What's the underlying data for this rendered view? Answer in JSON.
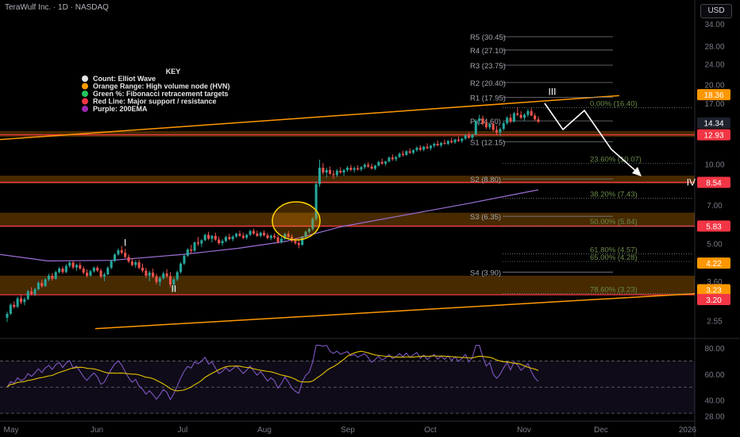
{
  "header": {
    "title": "TeraWulf Inc. · 1D · NASDAQ",
    "currency": "USD"
  },
  "key": {
    "title": "KEY",
    "items": [
      {
        "color": "#e6e6e6",
        "label": "Count: Elliot Wave"
      },
      {
        "color": "#ff9800",
        "label": "Orange Range: High volume node (HVN)"
      },
      {
        "color": "#22c55e",
        "label": "Green %: Fibonacci retracement targets"
      },
      {
        "color": "#f23645",
        "label": "Red Line: Major support / resistance"
      },
      {
        "color": "#9c27b0",
        "label": "Purple: 200EMA"
      }
    ]
  },
  "colors": {
    "up": "#26a69a",
    "down": "#ef5350",
    "orange": "#ff9800",
    "red": "#f23645",
    "ema": "#9c6fd6",
    "rsi": "#7e57c2",
    "rsi_ma": "#e6c200",
    "grid_text": "#787b86"
  },
  "chart_data": [
    {
      "type": "candlestick",
      "y_scale": "log",
      "ylim": [
        2.2,
        36
      ],
      "y_ticks": [
        "34.00",
        "28.00",
        "24.00",
        "20.00",
        "17.00",
        "14.34",
        "12.93",
        "10.00",
        "8.54",
        "7.00",
        "5.83",
        "5.00",
        "4.22",
        "3.60",
        "3.23",
        "3.20",
        "2.55"
      ],
      "x_ticks": [
        "May",
        "Jun",
        "Jul",
        "Aug",
        "Sep",
        "Oct",
        "Nov",
        "Dec",
        "2026"
      ],
      "price_labels": [
        {
          "text": "18.36",
          "value": 18.36,
          "color": "#ff9800"
        },
        {
          "text": "14.34",
          "value": 14.34,
          "color": "#1e222d"
        },
        {
          "text": "12.93",
          "value": 12.93,
          "color": "#f23645"
        },
        {
          "text": "8.54",
          "value": 8.54,
          "color": "#f23645"
        },
        {
          "text": "5.83",
          "value": 5.83,
          "color": "#f23645"
        },
        {
          "text": "4.22",
          "value": 4.22,
          "color": "#ff9800"
        },
        {
          "text": "3.23",
          "value": 3.23,
          "color": "#ff9800"
        },
        {
          "text": "3.20",
          "value": 3.2,
          "color": "#f23645"
        }
      ],
      "pivots": [
        {
          "label": "R5 (30.45)",
          "value": 30.45
        },
        {
          "label": "R4 (27.10)",
          "value": 27.1
        },
        {
          "label": "R3 (23.75)",
          "value": 23.75
        },
        {
          "label": "R2 (20.40)",
          "value": 20.4
        },
        {
          "label": "R1 (17.95)",
          "value": 17.95
        },
        {
          "label": "P (14.60)",
          "value": 14.6
        },
        {
          "label": "S1 (12.15)",
          "value": 12.15
        },
        {
          "label": "S2 (8.80)",
          "value": 8.8
        },
        {
          "label": "S3 (6.35)",
          "value": 6.35
        },
        {
          "label": "S4 (3.90)",
          "value": 3.9
        }
      ],
      "fib_levels": [
        {
          "label": "0.00% (16.40)",
          "value": 16.4
        },
        {
          "label": "23.60% (10.07)",
          "value": 10.07
        },
        {
          "label": "38.20% (7.43)",
          "value": 7.43
        },
        {
          "label": "50.00% (5.84)",
          "value": 5.84
        },
        {
          "label": "61.80% (4.57)",
          "value": 4.57
        },
        {
          "label": "65.00% (4.28)",
          "value": 4.28
        },
        {
          "label": "78.60% (3.23)",
          "value": 3.23
        }
      ],
      "hvn_zones": [
        [
          12.7,
          13.35
        ],
        [
          8.45,
          9.05
        ],
        [
          5.78,
          6.55
        ],
        [
          3.2,
          3.78
        ]
      ],
      "support_lines": [
        12.93,
        8.54,
        5.83,
        3.2
      ],
      "wave_labels": [
        {
          "text": "I",
          "value": 4.9,
          "day": 34
        },
        {
          "text": "II",
          "value": 3.28,
          "day": 48
        },
        {
          "text": "III",
          "value": 18.3,
          "day": 157
        },
        {
          "text": "IV",
          "value": 8.3,
          "day": 197
        }
      ],
      "candles": [
        [
          2.62,
          2.76,
          2.52,
          2.71
        ],
        [
          2.71,
          2.97,
          2.68,
          2.93
        ],
        [
          2.93,
          3.02,
          2.84,
          2.88
        ],
        [
          2.88,
          3.15,
          2.85,
          3.1
        ],
        [
          3.1,
          3.2,
          2.95,
          3.0
        ],
        [
          3.0,
          3.13,
          2.92,
          3.08
        ],
        [
          3.08,
          3.34,
          3.05,
          3.3
        ],
        [
          3.3,
          3.42,
          3.18,
          3.22
        ],
        [
          3.22,
          3.4,
          3.16,
          3.36
        ],
        [
          3.36,
          3.6,
          3.32,
          3.55
        ],
        [
          3.55,
          3.65,
          3.4,
          3.45
        ],
        [
          3.45,
          3.7,
          3.42,
          3.66
        ],
        [
          3.66,
          3.85,
          3.6,
          3.78
        ],
        [
          3.78,
          3.86,
          3.62,
          3.68
        ],
        [
          3.68,
          3.95,
          3.65,
          3.9
        ],
        [
          3.9,
          4.08,
          3.85,
          4.02
        ],
        [
          4.02,
          4.1,
          3.84,
          3.9
        ],
        [
          3.9,
          4.18,
          3.86,
          4.12
        ],
        [
          4.12,
          4.3,
          4.05,
          4.24
        ],
        [
          4.24,
          4.3,
          4.0,
          4.06
        ],
        [
          4.06,
          4.2,
          3.95,
          4.15
        ],
        [
          4.15,
          4.25,
          3.98,
          4.02
        ],
        [
          4.02,
          4.1,
          3.82,
          3.88
        ],
        [
          3.88,
          4.0,
          3.72,
          3.78
        ],
        [
          3.78,
          3.98,
          3.75,
          3.93
        ],
        [
          3.93,
          4.1,
          3.88,
          4.05
        ],
        [
          4.05,
          4.12,
          3.9,
          3.95
        ],
        [
          3.95,
          4.02,
          3.7,
          3.75
        ],
        [
          3.75,
          3.88,
          3.6,
          3.82
        ],
        [
          3.82,
          4.1,
          3.8,
          4.05
        ],
        [
          4.05,
          4.35,
          4.0,
          4.3
        ],
        [
          4.3,
          4.6,
          4.25,
          4.55
        ],
        [
          4.55,
          4.8,
          4.5,
          4.72
        ],
        [
          4.72,
          4.9,
          4.55,
          4.62
        ],
        [
          4.62,
          4.78,
          4.4,
          4.45
        ],
        [
          4.45,
          4.55,
          4.22,
          4.28
        ],
        [
          4.28,
          4.4,
          4.1,
          4.15
        ],
        [
          4.15,
          4.32,
          4.05,
          4.25
        ],
        [
          4.25,
          4.35,
          4.0,
          4.05
        ],
        [
          4.05,
          4.2,
          3.88,
          3.95
        ],
        [
          3.95,
          4.05,
          3.7,
          3.78
        ],
        [
          3.78,
          3.95,
          3.6,
          3.88
        ],
        [
          3.88,
          4.02,
          3.7,
          3.75
        ],
        [
          3.75,
          3.85,
          3.5,
          3.58
        ],
        [
          3.58,
          3.75,
          3.45,
          3.7
        ],
        [
          3.7,
          3.92,
          3.65,
          3.85
        ],
        [
          3.85,
          4.0,
          3.7,
          3.76
        ],
        [
          3.76,
          3.9,
          3.42,
          3.5
        ],
        [
          3.5,
          3.72,
          3.3,
          3.66
        ],
        [
          3.66,
          3.95,
          3.6,
          3.9
        ],
        [
          3.9,
          4.25,
          3.85,
          4.2
        ],
        [
          4.2,
          4.55,
          4.15,
          4.5
        ],
        [
          4.5,
          4.8,
          4.45,
          4.75
        ],
        [
          4.75,
          4.95,
          4.6,
          4.7
        ],
        [
          4.7,
          5.1,
          4.65,
          5.05
        ],
        [
          5.05,
          5.3,
          4.9,
          5.0
        ],
        [
          5.0,
          5.2,
          4.85,
          5.15
        ],
        [
          5.15,
          5.45,
          5.1,
          5.4
        ],
        [
          5.4,
          5.55,
          5.15,
          5.22
        ],
        [
          5.22,
          5.4,
          5.05,
          5.35
        ],
        [
          5.35,
          5.5,
          5.12,
          5.18
        ],
        [
          5.18,
          5.32,
          4.95,
          5.02
        ],
        [
          5.02,
          5.2,
          4.9,
          5.12
        ],
        [
          5.12,
          5.35,
          5.05,
          5.3
        ],
        [
          5.3,
          5.45,
          5.15,
          5.2
        ],
        [
          5.2,
          5.38,
          5.1,
          5.32
        ],
        [
          5.32,
          5.5,
          5.25,
          5.45
        ],
        [
          5.45,
          5.6,
          5.3,
          5.36
        ],
        [
          5.36,
          5.5,
          5.2,
          5.26
        ],
        [
          5.26,
          5.45,
          5.18,
          5.4
        ],
        [
          5.4,
          5.65,
          5.35,
          5.58
        ],
        [
          5.58,
          5.7,
          5.4,
          5.46
        ],
        [
          5.46,
          5.6,
          5.3,
          5.35
        ],
        [
          5.35,
          5.55,
          5.28,
          5.5
        ],
        [
          5.5,
          5.62,
          5.32,
          5.38
        ],
        [
          5.38,
          5.5,
          5.2,
          5.25
        ],
        [
          5.25,
          5.42,
          5.15,
          5.36
        ],
        [
          5.36,
          5.48,
          5.2,
          5.28
        ],
        [
          5.28,
          5.4,
          5.0,
          5.08
        ],
        [
          5.08,
          5.3,
          5.0,
          5.22
        ],
        [
          5.22,
          5.5,
          5.15,
          5.44
        ],
        [
          5.44,
          5.58,
          5.25,
          5.3
        ],
        [
          5.3,
          5.42,
          5.05,
          5.12
        ],
        [
          5.12,
          5.25,
          4.95,
          5.02
        ],
        [
          5.02,
          5.2,
          4.8,
          4.95
        ],
        [
          4.95,
          5.35,
          4.9,
          5.3
        ],
        [
          5.3,
          5.6,
          5.25,
          5.55
        ],
        [
          5.55,
          5.75,
          5.45,
          5.68
        ],
        [
          5.68,
          6.3,
          5.6,
          6.2
        ],
        [
          6.2,
          8.6,
          6.1,
          8.4
        ],
        [
          8.4,
          10.4,
          8.2,
          9.7
        ],
        [
          9.7,
          10.1,
          9.1,
          9.3
        ],
        [
          9.3,
          9.7,
          8.9,
          9.5
        ],
        [
          9.5,
          9.8,
          9.1,
          9.2
        ],
        [
          9.2,
          9.5,
          8.8,
          9.1
        ],
        [
          9.1,
          9.6,
          8.95,
          9.45
        ],
        [
          9.45,
          9.75,
          9.2,
          9.3
        ],
        [
          9.3,
          9.6,
          9.05,
          9.5
        ],
        [
          9.5,
          9.85,
          9.35,
          9.7
        ],
        [
          9.7,
          9.95,
          9.4,
          9.52
        ],
        [
          9.52,
          9.8,
          9.3,
          9.66
        ],
        [
          9.66,
          9.9,
          9.45,
          9.55
        ],
        [
          9.55,
          9.85,
          9.4,
          9.75
        ],
        [
          9.75,
          10.1,
          9.6,
          9.95
        ],
        [
          9.95,
          10.2,
          9.7,
          9.8
        ],
        [
          9.8,
          10.05,
          9.55,
          9.62
        ],
        [
          9.62,
          9.95,
          9.5,
          9.88
        ],
        [
          9.88,
          10.3,
          9.8,
          10.2
        ],
        [
          10.2,
          10.5,
          9.95,
          10.05
        ],
        [
          10.05,
          10.3,
          9.85,
          10.25
        ],
        [
          10.25,
          10.7,
          10.15,
          10.6
        ],
        [
          10.6,
          10.9,
          10.3,
          10.45
        ],
        [
          10.45,
          10.75,
          10.25,
          10.65
        ],
        [
          10.65,
          11.1,
          10.55,
          10.95
        ],
        [
          10.95,
          11.25,
          10.7,
          10.85
        ],
        [
          10.85,
          11.3,
          10.75,
          11.2
        ],
        [
          11.2,
          11.5,
          10.95,
          11.05
        ],
        [
          11.05,
          11.4,
          10.9,
          11.3
        ],
        [
          11.3,
          11.7,
          11.15,
          11.55
        ],
        [
          11.55,
          11.8,
          11.2,
          11.35
        ],
        [
          11.35,
          11.75,
          11.2,
          11.65
        ],
        [
          11.65,
          12.0,
          11.4,
          11.5
        ],
        [
          11.5,
          11.85,
          11.3,
          11.75
        ],
        [
          11.75,
          12.1,
          11.55,
          11.95
        ],
        [
          11.95,
          12.3,
          11.7,
          11.8
        ],
        [
          11.8,
          12.15,
          11.6,
          12.05
        ],
        [
          12.05,
          12.4,
          11.85,
          11.95
        ],
        [
          11.95,
          12.35,
          11.8,
          12.25
        ],
        [
          12.25,
          12.6,
          12.0,
          12.1
        ],
        [
          12.1,
          12.5,
          11.95,
          12.4
        ],
        [
          12.4,
          12.75,
          12.15,
          12.25
        ],
        [
          12.25,
          12.6,
          12.05,
          12.5
        ],
        [
          12.5,
          13.0,
          12.35,
          12.85
        ],
        [
          12.85,
          13.2,
          12.5,
          12.6
        ],
        [
          12.6,
          13.05,
          12.4,
          12.95
        ],
        [
          12.95,
          14.8,
          12.9,
          14.6
        ],
        [
          14.6,
          15.4,
          14.2,
          14.9
        ],
        [
          14.9,
          15.3,
          14.0,
          14.3
        ],
        [
          14.3,
          14.7,
          13.6,
          13.8
        ],
        [
          13.8,
          14.4,
          13.5,
          14.2
        ],
        [
          14.2,
          14.5,
          13.3,
          13.5
        ],
        [
          13.5,
          14.0,
          12.9,
          13.2
        ],
        [
          13.2,
          13.8,
          12.8,
          13.6
        ],
        [
          13.6,
          14.5,
          13.4,
          14.3
        ],
        [
          14.3,
          15.2,
          14.1,
          15.0
        ],
        [
          15.0,
          15.5,
          14.3,
          14.5
        ],
        [
          14.5,
          15.8,
          14.4,
          15.6
        ],
        [
          15.6,
          16.4,
          15.2,
          15.4
        ],
        [
          15.4,
          15.9,
          14.8,
          15.0
        ],
        [
          15.0,
          15.6,
          14.6,
          15.4
        ],
        [
          15.4,
          16.2,
          15.1,
          15.9
        ],
        [
          15.9,
          16.35,
          15.2,
          15.3
        ],
        [
          15.3,
          15.6,
          14.6,
          14.8
        ],
        [
          14.8,
          15.2,
          14.3,
          14.5
        ]
      ]
    },
    {
      "type": "line",
      "name": "RSI",
      "ylim": [
        24,
        86
      ],
      "y_ticks": [
        "80.00",
        "60.00",
        "40.00",
        "28.00"
      ],
      "bands": [
        70,
        50,
        30
      ]
    }
  ]
}
